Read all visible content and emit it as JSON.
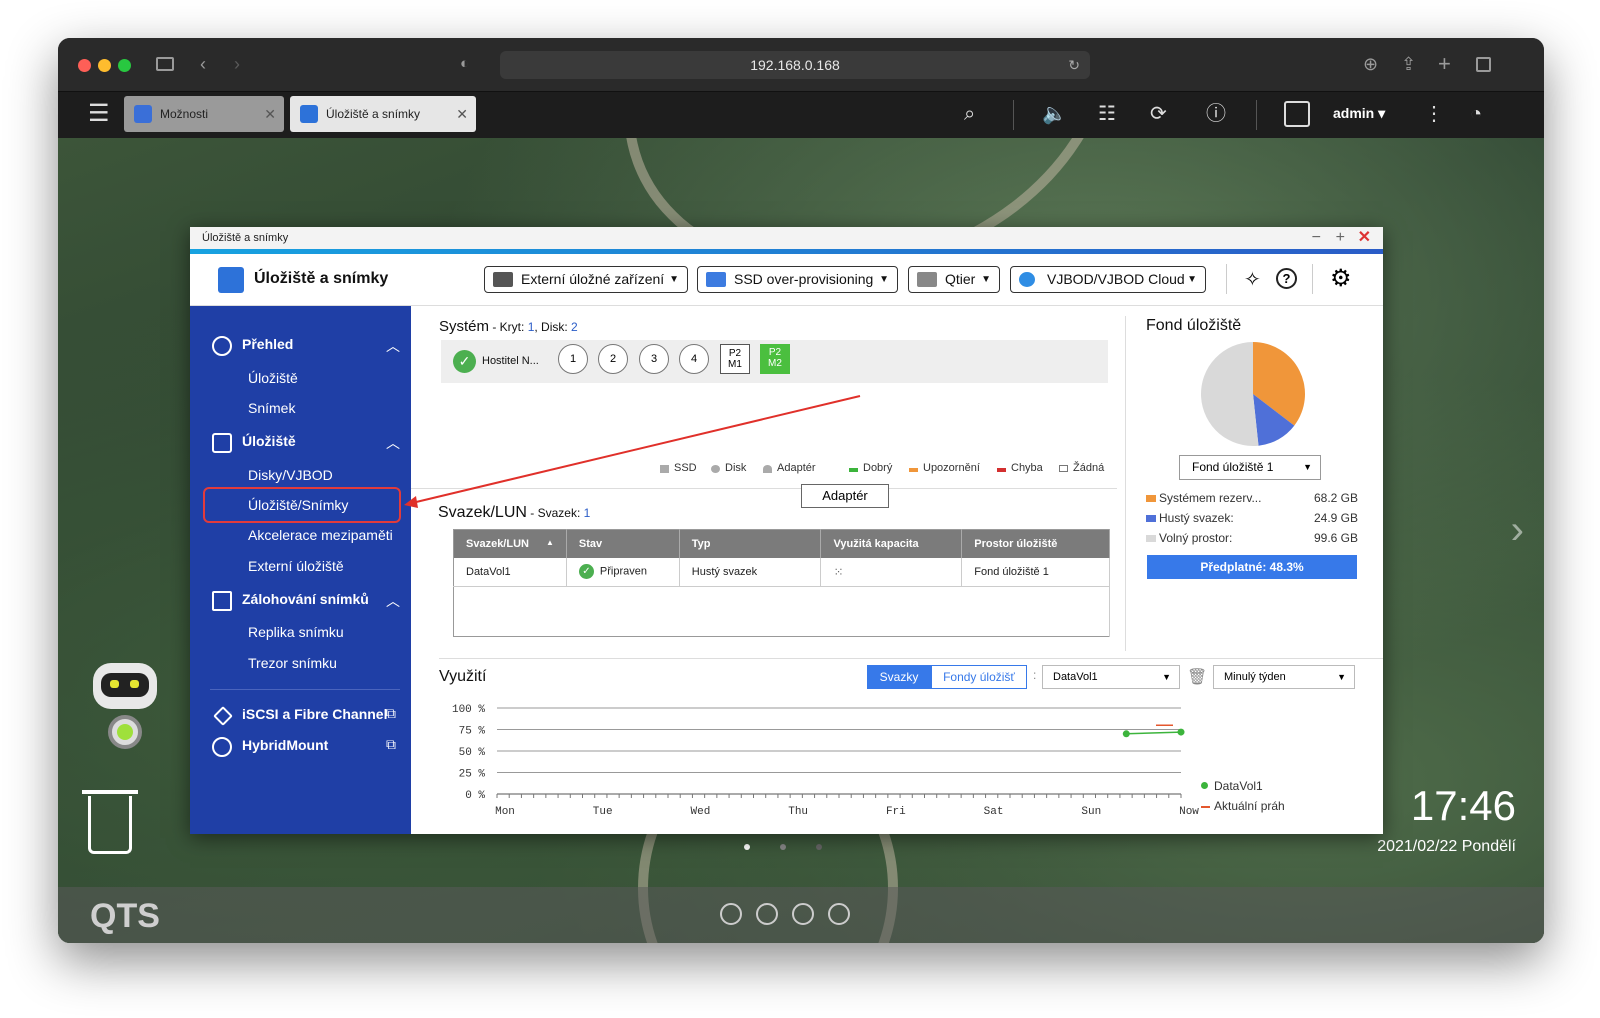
{
  "browser": {
    "url": "192.168.0.168"
  },
  "qts_tabs": [
    {
      "label": "Možnosti"
    },
    {
      "label": "Úložiště a snímky"
    }
  ],
  "qts_user": "admin",
  "window": {
    "title_small": "Úložiště a snímky",
    "app_title": "Úložiště a snímky"
  },
  "toolbar": {
    "ext": "Externí úložné zařízení",
    "ssd": "SSD over-provisioning",
    "qtier": "Qtier",
    "vjbod": "VJBOD/VJBOD Cloud"
  },
  "sidebar": {
    "overview": "Přehled",
    "storage_sub": "Úložiště",
    "snapshot_sub": "Snímek",
    "storage": "Úložiště",
    "disks": "Disky/VJBOD",
    "storage_snapshots": "Úložiště/Snímky",
    "cache": "Akcelerace mezipaměti",
    "external": "Externí úložiště",
    "backup": "Zálohování snímků",
    "replica": "Replika snímku",
    "vault": "Trezor snímku",
    "iscsi": "iSCSI a Fibre Channel",
    "hybrid": "HybridMount"
  },
  "system": {
    "title": "Systém",
    "sub_prefix": " - Kryt: ",
    "enclosure": "1",
    "sub_mid": ", Disk: ",
    "disk": "2",
    "host": "Hostitel N...",
    "bays": [
      "1",
      "2",
      "3",
      "4"
    ],
    "p2m1": [
      "P2",
      "M1"
    ],
    "p2m2": [
      "P2",
      "M2"
    ],
    "legend": [
      "SSD",
      "Disk",
      "Adaptér",
      "Dobrý",
      "Upozornění",
      "Chyba",
      "Žádná"
    ],
    "tooltip": "Adaptér"
  },
  "volume": {
    "title": "Svazek/LUN",
    "sub": " - Svazek: ",
    "count": "1",
    "headers": [
      "Svazek/LUN",
      "Stav",
      "Typ",
      "Využitá kapacita",
      "Prostor úložiště"
    ],
    "row": {
      "name": "DataVol1",
      "status": "Připraven",
      "type": "Hustý svazek",
      "pool": "Fond úložiště 1"
    }
  },
  "pool": {
    "title": "Fond úložiště",
    "select": "Fond úložiště 1",
    "rows": [
      {
        "label": "Systémem rezerv...",
        "value": "68.2 GB",
        "color": "#f0963a"
      },
      {
        "label": "Hustý svazek:",
        "value": "24.9 GB",
        "color": "#4f70d8"
      },
      {
        "label": "Volný prostor:",
        "value": "99.6 GB",
        "color": "#d9d9d9"
      }
    ],
    "subscribed": "Předplatné: 48.3%",
    "chart_data": {
      "type": "pie",
      "values": [
        68.2,
        24.9,
        99.6
      ],
      "labels": [
        "Systémem rezerv...",
        "Hustý svazek:",
        "Volný prostor:"
      ]
    }
  },
  "usage": {
    "title": "Využití",
    "tab_volumes": "Svazky",
    "tab_pools": "Fondy úložišť",
    "volume_select": "DataVol1",
    "period_select": "Minulý týden",
    "legend": [
      "DataVol1",
      "Aktuální práh"
    ],
    "chart_data": {
      "type": "line",
      "categories": [
        "Mon",
        "Tue",
        "Wed",
        "Thu",
        "Fri",
        "Sat",
        "Sun",
        "Now"
      ],
      "y_ticks": [
        "100 %",
        "75 %",
        "50 %",
        "25 %",
        "0 %"
      ],
      "ylim": [
        0,
        100
      ],
      "series": [
        {
          "name": "DataVol1",
          "points": [
            [
              0.92,
              70
            ],
            [
              1.0,
              72
            ]
          ]
        },
        {
          "name": "Aktuální práh",
          "values": [
            80,
            80
          ]
        }
      ]
    }
  },
  "desktop": {
    "time": "17:46",
    "date": "2021/02/22 Pondělí",
    "logo": "QTS"
  }
}
